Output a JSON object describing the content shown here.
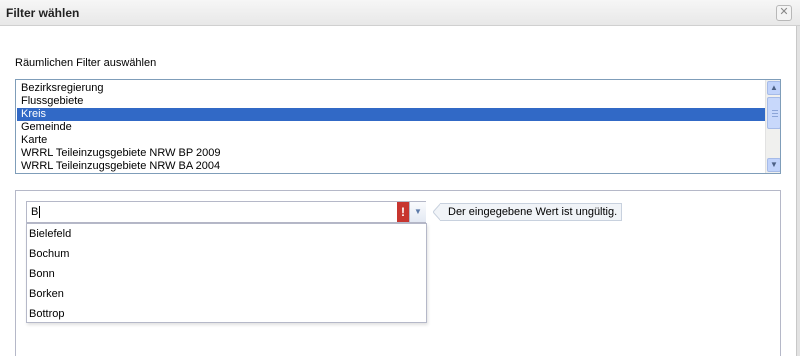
{
  "window": {
    "title": "Filter wählen",
    "close_glyph": "✕"
  },
  "spatial_filter": {
    "label": "Räumlichen Filter auswählen",
    "items": [
      "Bezirksregierung",
      "Flussgebiete",
      "Kreis",
      "Gemeinde",
      "Karte",
      "WRRL Teileinzugsgebiete NRW BP 2009",
      "WRRL Teileinzugsgebiete NRW BA 2004"
    ],
    "selected": "Kreis"
  },
  "combo": {
    "value": "B",
    "error_glyph": "!",
    "error_message": "Der eingegebene Wert ist ungültig.",
    "options": [
      "Bielefeld",
      "Bochum",
      "Bonn",
      "Borken",
      "Bottrop"
    ]
  },
  "icons": {
    "close": "close-icon",
    "scroll_up": "arrow-up-icon",
    "scroll_down": "arrow-down-icon",
    "error": "error-icon",
    "trigger": "chevron-down-icon"
  },
  "colors": {
    "selection": "#3169c6",
    "error": "#c7352f",
    "border": "#7f9db9"
  }
}
